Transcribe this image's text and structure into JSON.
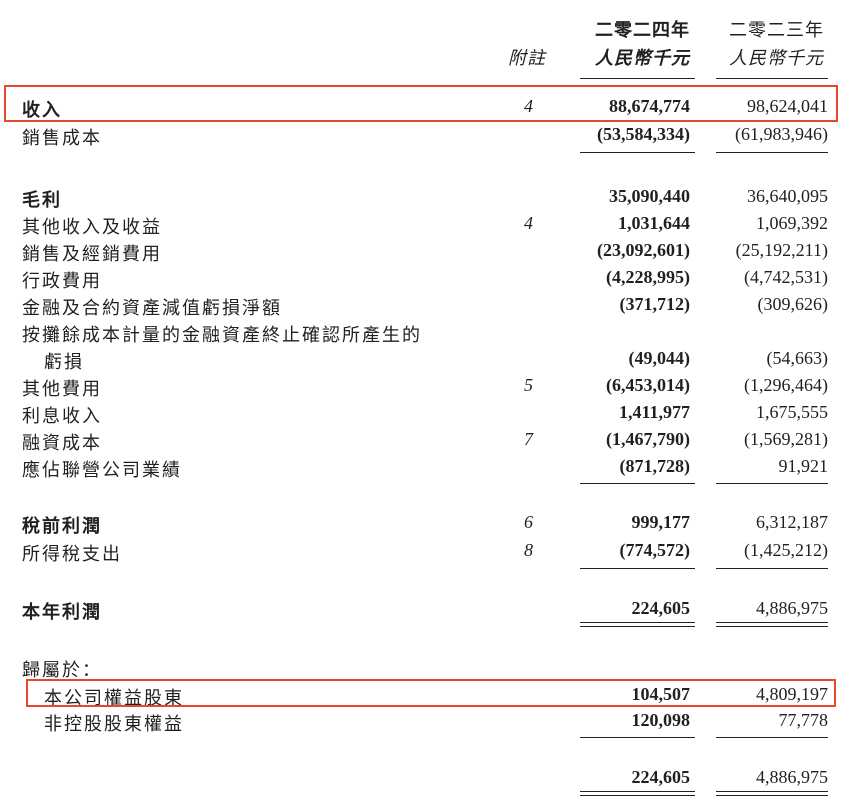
{
  "header": {
    "current_year": "二零二四年",
    "prior_year": "二零二三年",
    "notes_label": "附註",
    "current_unit": "人民幣千元",
    "prior_unit": "人民幣千元"
  },
  "rows": [
    {
      "label": "收入",
      "note": "4",
      "cy": "88,674,774",
      "py": "98,624,041"
    },
    {
      "label": "銷售成本",
      "note": "",
      "cy": "(53,584,334)",
      "py": "(61,983,946)"
    },
    {
      "label": "毛利",
      "note": "",
      "cy": "35,090,440",
      "py": "36,640,095"
    },
    {
      "label": "其他收入及收益",
      "note": "4",
      "cy": "1,031,644",
      "py": "1,069,392"
    },
    {
      "label": "銷售及經銷費用",
      "note": "",
      "cy": "(23,092,601)",
      "py": "(25,192,211)"
    },
    {
      "label": "行政費用",
      "note": "",
      "cy": "(4,228,995)",
      "py": "(4,742,531)"
    },
    {
      "label": "金融及合約資產減值虧損淨額",
      "note": "",
      "cy": "(371,712)",
      "py": "(309,626)"
    },
    {
      "label": "按攤餘成本計量的金融資產終止確認所產生的",
      "note": "",
      "cy": "",
      "py": ""
    },
    {
      "label": "虧損",
      "note": "",
      "cy": "(49,044)",
      "py": "(54,663)"
    },
    {
      "label": "其他費用",
      "note": "5",
      "cy": "(6,453,014)",
      "py": "(1,296,464)"
    },
    {
      "label": "利息收入",
      "note": "",
      "cy": "1,411,977",
      "py": "1,675,555"
    },
    {
      "label": "融資成本",
      "note": "7",
      "cy": "(1,467,790)",
      "py": "(1,569,281)"
    },
    {
      "label": "應佔聯營公司業績",
      "note": "",
      "cy": "(871,728)",
      "py": "91,921"
    },
    {
      "label": "稅前利潤",
      "note": "6",
      "cy": "999,177",
      "py": "6,312,187"
    },
    {
      "label": "所得稅支出",
      "note": "8",
      "cy": "(774,572)",
      "py": "(1,425,212)"
    },
    {
      "label": "本年利潤",
      "note": "",
      "cy": "224,605",
      "py": "4,886,975"
    },
    {
      "label": "歸屬於：",
      "note": "",
      "cy": "",
      "py": ""
    },
    {
      "label": "本公司權益股東",
      "note": "",
      "cy": "104,507",
      "py": "4,809,197"
    },
    {
      "label": "非控股股東權益",
      "note": "",
      "cy": "120,098",
      "py": "77,778"
    },
    {
      "label": "",
      "note": "",
      "cy": "224,605",
      "py": "4,886,975"
    }
  ],
  "colors": {
    "text": "#231f20",
    "highlight": "#e8472f"
  }
}
